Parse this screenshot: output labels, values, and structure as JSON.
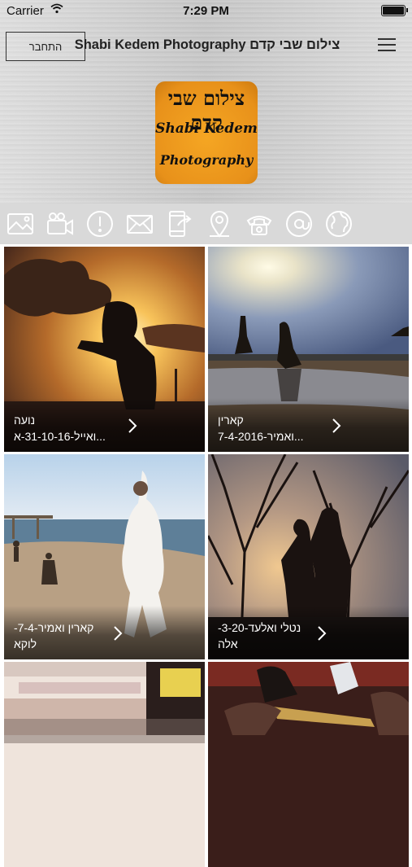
{
  "status_bar": {
    "carrier": "Carrier",
    "time": "7:29 PM"
  },
  "header": {
    "login_label": "התחבר",
    "title": "Shabi Kedem Photography צילום שבי קדם",
    "menu_icon": "hamburger-menu-icon"
  },
  "logo": {
    "line1": "צילום שבי קדם",
    "line2": "Shabi Kedem",
    "line3": "Photography"
  },
  "icon_bar": [
    {
      "icon": "gallery-icon"
    },
    {
      "icon": "video-camera-icon"
    },
    {
      "icon": "info-icon"
    },
    {
      "icon": "envelope-icon"
    },
    {
      "icon": "share-phone-icon"
    },
    {
      "icon": "location-pin-icon"
    },
    {
      "icon": "telephone-icon"
    },
    {
      "icon": "at-email-icon"
    },
    {
      "icon": "globe-icon"
    }
  ],
  "gallery": [
    {
      "line1": "נועה",
      "line2": "...ואייל-31-10-16-א"
    },
    {
      "line1": "קארין",
      "line2": "...ואמיר-7-4-2016"
    },
    {
      "line1": "קארין ואמיר-7-4-",
      "line2": "לוקא"
    },
    {
      "line1": "נטלי ואלעד-3-20-",
      "line2": "אלה"
    },
    {
      "line1": "",
      "line2": ""
    },
    {
      "line1": "",
      "line2": ""
    }
  ],
  "colors": {
    "logo_orange": "#f0a020",
    "icon_bar_bg": "#d9d9d9"
  }
}
